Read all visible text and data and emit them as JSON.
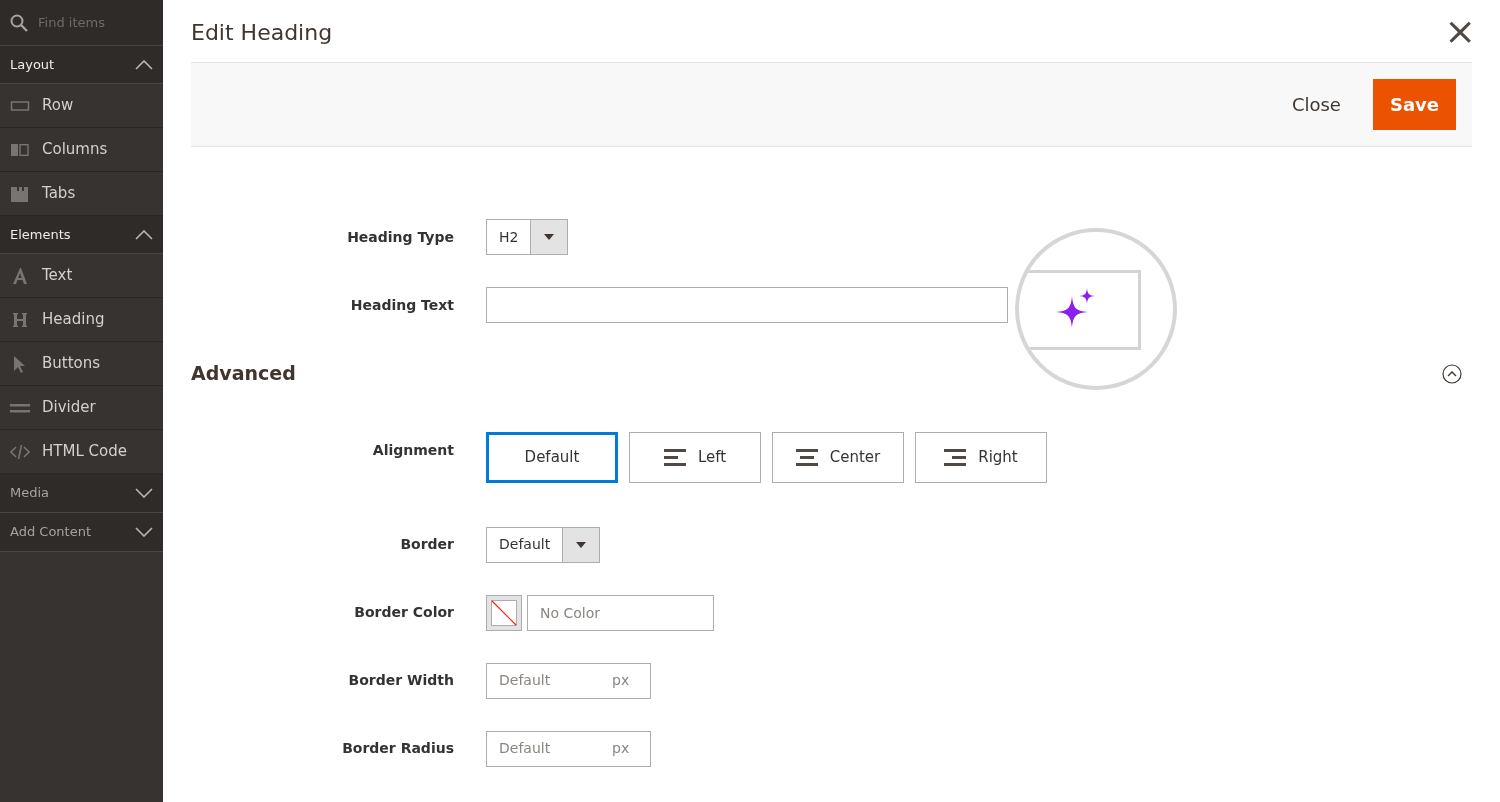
{
  "sidebar": {
    "search": {
      "placeholder": "Find items"
    },
    "groups": [
      {
        "label": "Layout",
        "expanded": true,
        "items": [
          "Row",
          "Columns",
          "Tabs"
        ]
      },
      {
        "label": "Elements",
        "expanded": true,
        "items": [
          "Text",
          "Heading",
          "Buttons",
          "Divider",
          "HTML Code"
        ]
      },
      {
        "label": "Media",
        "expanded": false
      },
      {
        "label": "Add Content",
        "expanded": false
      }
    ]
  },
  "modal": {
    "title": "Edit Heading",
    "close_symbol": "×",
    "actions": [
      "Close",
      "Save"
    ]
  },
  "fields": [
    {
      "kind": "select",
      "label": "Heading Type",
      "value": "H2"
    },
    {
      "kind": "text",
      "label": "Heading Text"
    }
  ],
  "advanced": {
    "title": "Advanced",
    "expanded": true,
    "fields": [
      {
        "kind": "segmented",
        "label": "Alignment",
        "options": [
          {
            "label": "Default",
            "selected": true
          },
          {
            "label": "Left",
            "selected": false
          },
          {
            "label": "Center",
            "selected": false
          },
          {
            "label": "Right",
            "selected": false
          }
        ]
      },
      {
        "kind": "select",
        "label": "Border",
        "value": "Default"
      },
      {
        "kind": "color",
        "label": "Border Color",
        "placeholder": "No Color"
      },
      {
        "kind": "unit",
        "label": "Border Width",
        "placeholder": "Default",
        "unit": "px"
      },
      {
        "kind": "unit",
        "label": "Border Radius",
        "placeholder": "Default",
        "unit": "px"
      }
    ]
  }
}
